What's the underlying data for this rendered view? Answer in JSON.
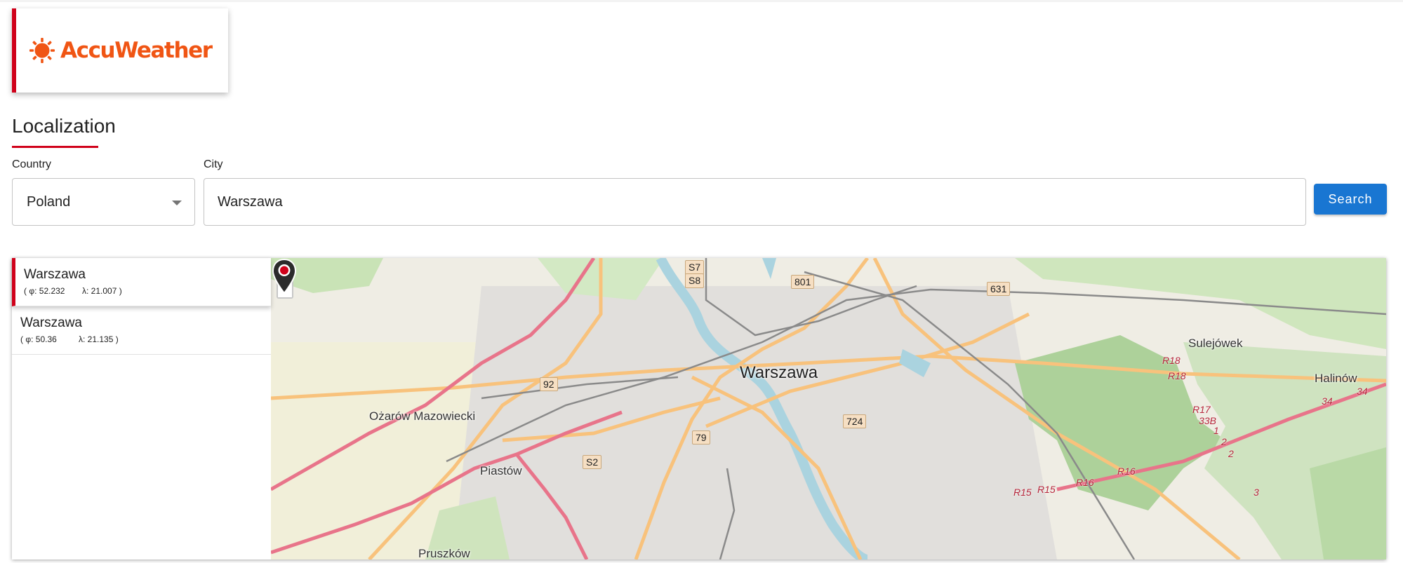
{
  "brand": {
    "name": "AccuWeather",
    "color": "#f05514"
  },
  "section": {
    "title": "Localization",
    "accent": "#d0021b"
  },
  "form": {
    "country_label": "Country",
    "country_value": "Poland",
    "city_label": "City",
    "city_value": "Warszawa",
    "search_label": "Search"
  },
  "results": [
    {
      "name": "Warszawa",
      "lat": "( φ: 52.232",
      "lon": "λ: 21.007 )",
      "selected": true
    },
    {
      "name": "Warszawa",
      "lat": "( φ: 50.36",
      "lon": "λ: 21.135 )",
      "selected": false
    }
  ],
  "map": {
    "zoom_in": "+",
    "zoom_out": "−",
    "marker_icon": "map-pin-icon",
    "place_labels": {
      "warszawa": "Warszawa",
      "sulejowek": "Sulejówek",
      "halinow": "Halinów",
      "ozarow": "Ożarów Mazowiecki",
      "piastow": "Piastów",
      "pruszkow": "Pruszków"
    },
    "road_shields": {
      "s7": "S7",
      "s8": "S8",
      "r801": "801",
      "r631": "631",
      "r92": "92",
      "r724": "724",
      "r79": "79",
      "s2": "S2"
    },
    "route_labels": {
      "r18a": "R18",
      "r18b": "R18",
      "r17": "R17",
      "r33b": "33B",
      "r1": "1",
      "r2a": "2",
      "r2b": "2",
      "r34a": "34",
      "r34b": "34",
      "r16a": "R16",
      "r16b": "R16",
      "r15a": "R15",
      "r15b": "R15",
      "r3": "3"
    }
  }
}
